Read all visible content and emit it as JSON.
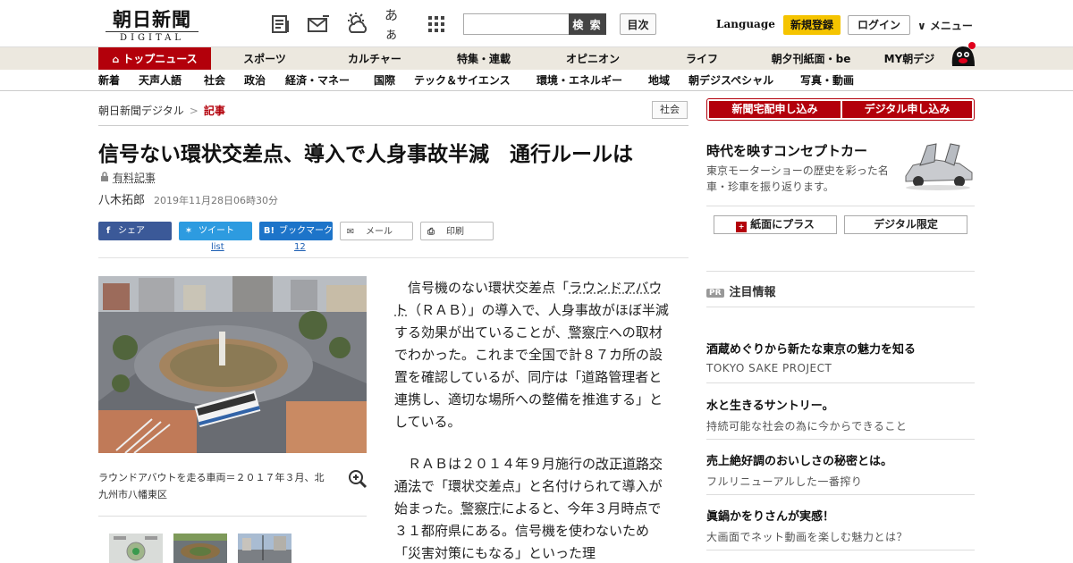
{
  "header": {
    "logo_main": "朝日新聞",
    "logo_sub": "DIGITAL",
    "icons": [
      "newspaper-icon",
      "mail-icon",
      "weather-icon",
      "font-size-icon",
      "grid-menu-icon"
    ],
    "font_size_glyph": "あぁ",
    "search_placeholder": "",
    "search_button": "検 索",
    "toc_button": "目次",
    "language": "Language",
    "register": "新規登録",
    "login": "ログイン",
    "menu": "∨ メニュー"
  },
  "nav_main": [
    "トップニュース",
    "スポーツ",
    "カルチャー",
    "特集・連載",
    "オピニオン",
    "ライフ",
    "朝夕刊紙面・be",
    "MY朝デジ"
  ],
  "nav_sub": [
    "新着",
    "天声人語",
    "社会",
    "政治",
    "経済・マネー",
    "国際",
    "テック＆サイエンス",
    "環境・エネルギー",
    "地域",
    "朝デジスペシャル",
    "写真・動画"
  ],
  "breadcrumb": {
    "home": "朝日新聞デジタル",
    "sep": ">",
    "current": "記事"
  },
  "category_badge": "社会",
  "article": {
    "title": "信号ない環状交差点、導入で人身事故半減　通行ルールは",
    "paid_label": "有料記事",
    "author": "八木拓郎",
    "date": "2019年11月28日06時30分",
    "share": {
      "facebook": "シェア",
      "twitter": "ツイート",
      "twitter_count": "list",
      "hatena": "ブックマーク",
      "hatena_count": "12",
      "mail": "メール",
      "print": "印刷"
    },
    "caption": "ラウンドアバウトを走る車両＝２０１７年３月、北九州市八幡東区",
    "p1_a": "信号機のない環状交差点「",
    "p1_link1": "ラウンドアバウト",
    "p1_b": "（ＲＡＢ）」の導入で、人身事故がほぼ半減する効果が出ていることが、",
    "p1_link2": "警察庁",
    "p1_c": "への取材でわかった。これまで全国で計８７カ所の設置を確認しているが、同庁は「道路管理者と連携し、適切な場所への整備を推進する」としている。",
    "p2_a": "ＲＡＢは２０１４年９月施行の",
    "p2_link1": "改正道路交通法",
    "p2_b": "で「環状交差点」と名付けられて導入が始まった。",
    "p2_link2": "警察庁",
    "p2_c": "によると、今年３月時点で３１都府県にある。信号機を使わないため「災害対策にもなる」といった理"
  },
  "sidebar": {
    "delivery_button": "新聞宅配申し込み",
    "digital_button": "デジタル申し込み",
    "promo_title": "時代を映すコンセプトカー",
    "promo_text": "東京モーターショーの歴史を彩った名車・珍車を振り返ります。",
    "paper_plus": "紙面にプラス",
    "digital_only": "デジタル限定",
    "pr_badge": "PR",
    "pr_heading": "注目情報",
    "pr_items": [
      {
        "title": "酒蔵めぐりから新たな東京の魅力を知る",
        "sub": "TOKYO SAKE PROJECT"
      },
      {
        "title": "水と生きるサントリー。",
        "sub": "持続可能な社会の為に今からできること"
      },
      {
        "title": "売上絶好調のおいしさの秘密とは。",
        "sub": "フルリニューアルした一番搾り"
      },
      {
        "title": "眞鍋かをりさんが実感！",
        "sub": "大画面でネット動画を楽しむ魅力とは？"
      }
    ]
  }
}
